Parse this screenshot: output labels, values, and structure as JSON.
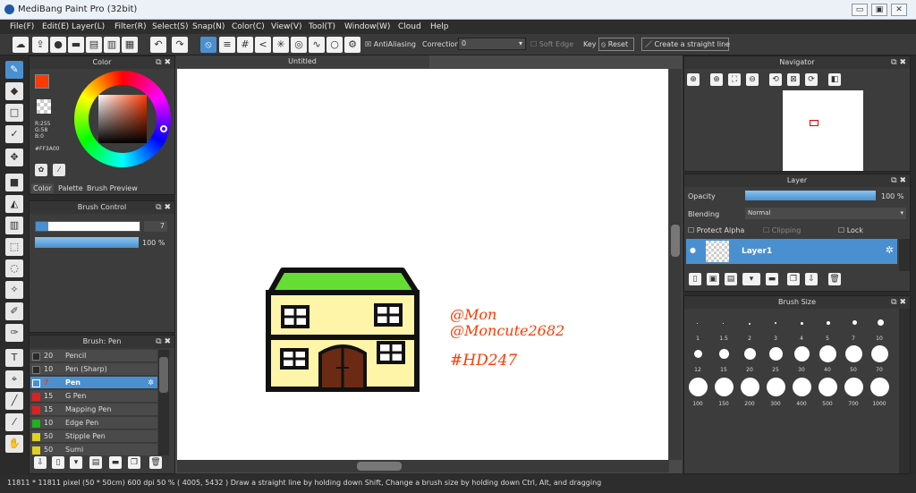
{
  "app": {
    "title": "MediBang Paint Pro (32bit)"
  },
  "menu": [
    "File(F)",
    "Edit(E)",
    "Layer(L)",
    "Filter(R)",
    "Select(S)",
    "Snap(N)",
    "Color(C)",
    "View(V)",
    "Tool(T)",
    "Window(W)",
    "Cloud",
    "Help"
  ],
  "toolbar": {
    "antialiasing": "AntiAliasing",
    "correction_label": "Correction",
    "correction_value": "0",
    "soft_edge": "Soft Edge",
    "key": "Key",
    "reset": "Reset",
    "straight_line": "Create a straight line"
  },
  "color_panel": {
    "title": "Color",
    "r": "R:255",
    "g": "G:58",
    "b": "B:0",
    "hex": "#FF3A00",
    "tabs": [
      "Color",
      "Palette",
      "Brush Preview"
    ],
    "fg_color": "#ff3a00"
  },
  "brush_control": {
    "title": "Brush Control",
    "size": "7",
    "opacity": "100 %"
  },
  "brush_panel": {
    "title": "Brush: Pen",
    "items": [
      {
        "num": "20",
        "name": "Pencil",
        "color": "#2a2a2a"
      },
      {
        "num": "10",
        "name": "Pen (Sharp)",
        "color": "#2a2a2a"
      },
      {
        "num": "7",
        "name": "Pen",
        "color": "#ff3a00"
      },
      {
        "num": "15",
        "name": "G Pen",
        "color": "#e02020"
      },
      {
        "num": "15",
        "name": "Mapping Pen",
        "color": "#e02020"
      },
      {
        "num": "10",
        "name": "Edge Pen",
        "color": "#20b020"
      },
      {
        "num": "50",
        "name": "Stipple Pen",
        "color": "#e0d020"
      },
      {
        "num": "50",
        "name": "Sumi",
        "color": "#e0d020"
      }
    ]
  },
  "document": {
    "tab": "Untitled"
  },
  "drawing": {
    "text1": "@Mon",
    "text2": "@Moncute2682",
    "text3": "#HD247"
  },
  "navigator": {
    "title": "Navigator"
  },
  "layer_panel": {
    "title": "Layer",
    "opacity_label": "Opacity",
    "opacity_value": "100 %",
    "blending_label": "Blending",
    "blending_value": "Normal",
    "protect_alpha": "Protect Alpha",
    "clipping": "Clipping",
    "lock": "Lock",
    "layer_name": "Layer1"
  },
  "brush_size": {
    "title": "Brush Size",
    "row1": [
      "1",
      "1.5",
      "2",
      "3",
      "4",
      "5",
      "7",
      "10"
    ],
    "row2": [
      "12",
      "15",
      "20",
      "25",
      "30",
      "40",
      "50",
      "70"
    ],
    "row3": [
      "100",
      "150",
      "200",
      "300",
      "400",
      "500",
      "700",
      "1000"
    ]
  },
  "status": "11811 * 11811 pixel  (50 * 50cm)  600 dpi  50 %  ( 4005, 5432 )  Draw a straight line by holding down Shift, Change a brush size by holding down Ctrl, Alt, and dragging"
}
